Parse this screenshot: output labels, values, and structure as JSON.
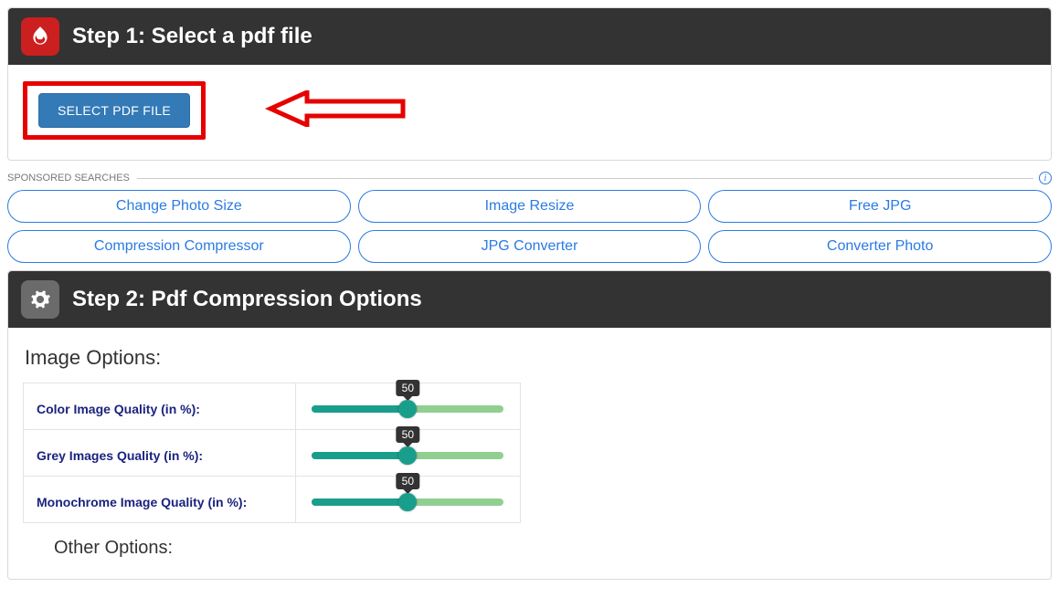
{
  "step1": {
    "title": "Step 1: Select a pdf file",
    "button_label": "SELECT PDF FILE"
  },
  "sponsored": {
    "label": "SPONSORED SEARCHES",
    "items": [
      "Change Photo Size",
      "Image Resize",
      "Free JPG",
      "Compression Compressor",
      "JPG Converter",
      "Converter Photo"
    ]
  },
  "step2": {
    "title": "Step 2: Pdf Compression Options",
    "image_options_heading": "Image Options:",
    "other_options_heading": "Other Options:",
    "sliders": {
      "color": {
        "label": "Color Image Quality (in %):",
        "value": "50"
      },
      "grey": {
        "label": "Grey Images Quality (in %):",
        "value": "50"
      },
      "mono": {
        "label": "Monochrome Image Quality (in %):",
        "value": "50"
      }
    }
  }
}
